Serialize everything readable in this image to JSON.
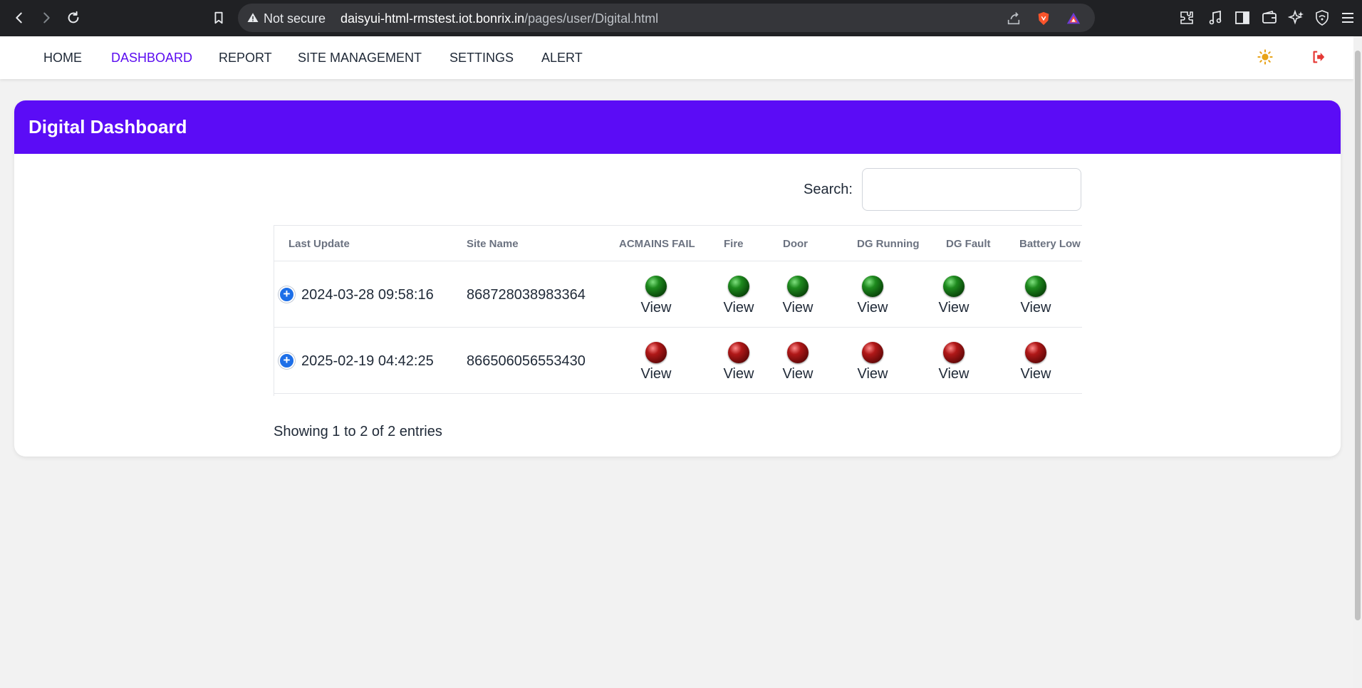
{
  "browser": {
    "security_label": "Not secure",
    "url_host": "daisyui-html-rmstest.iot.bonrix.in",
    "url_path": "/pages/user/Digital.html"
  },
  "nav": {
    "items": [
      "HOME",
      "DASHBOARD",
      "REPORT",
      "SITE MANAGEMENT",
      "SETTINGS",
      "ALERT"
    ],
    "active": "DASHBOARD"
  },
  "card": {
    "title": "Digital Dashboard"
  },
  "search": {
    "label": "Search:",
    "value": ""
  },
  "table": {
    "columns": [
      "Last Update",
      "Site Name",
      "ACMAINS FAIL",
      "Fire",
      "Door",
      "DG Running",
      "DG Fault",
      "Battery Low"
    ],
    "rows": [
      {
        "last_update": "2024-03-28 09:58:16",
        "site_name": "868728038983364",
        "status": [
          "green",
          "green",
          "green",
          "green",
          "green",
          "green"
        ],
        "view_label": "View"
      },
      {
        "last_update": "2025-02-19 04:42:25",
        "site_name": "866506056553430",
        "status": [
          "red",
          "red",
          "red",
          "red",
          "red",
          "red"
        ],
        "view_label": "View"
      }
    ]
  },
  "footer": {
    "entries_text": "Showing 1 to 2 of 2 entries"
  },
  "colors": {
    "brand": "#5b0cf6",
    "active_nav": "#5b0cf0",
    "status_ok": "#0b4d0b",
    "status_alarm": "#6d0a0a",
    "expand_button": "#1d6fe8"
  },
  "icons": {
    "back": "chevron-left-icon",
    "forward": "chevron-right-icon",
    "reload": "reload-icon",
    "bookmark": "bookmark-icon",
    "security": "warning-triangle-icon",
    "share": "share-icon",
    "theme": "sun-icon",
    "logout": "logout-icon"
  }
}
